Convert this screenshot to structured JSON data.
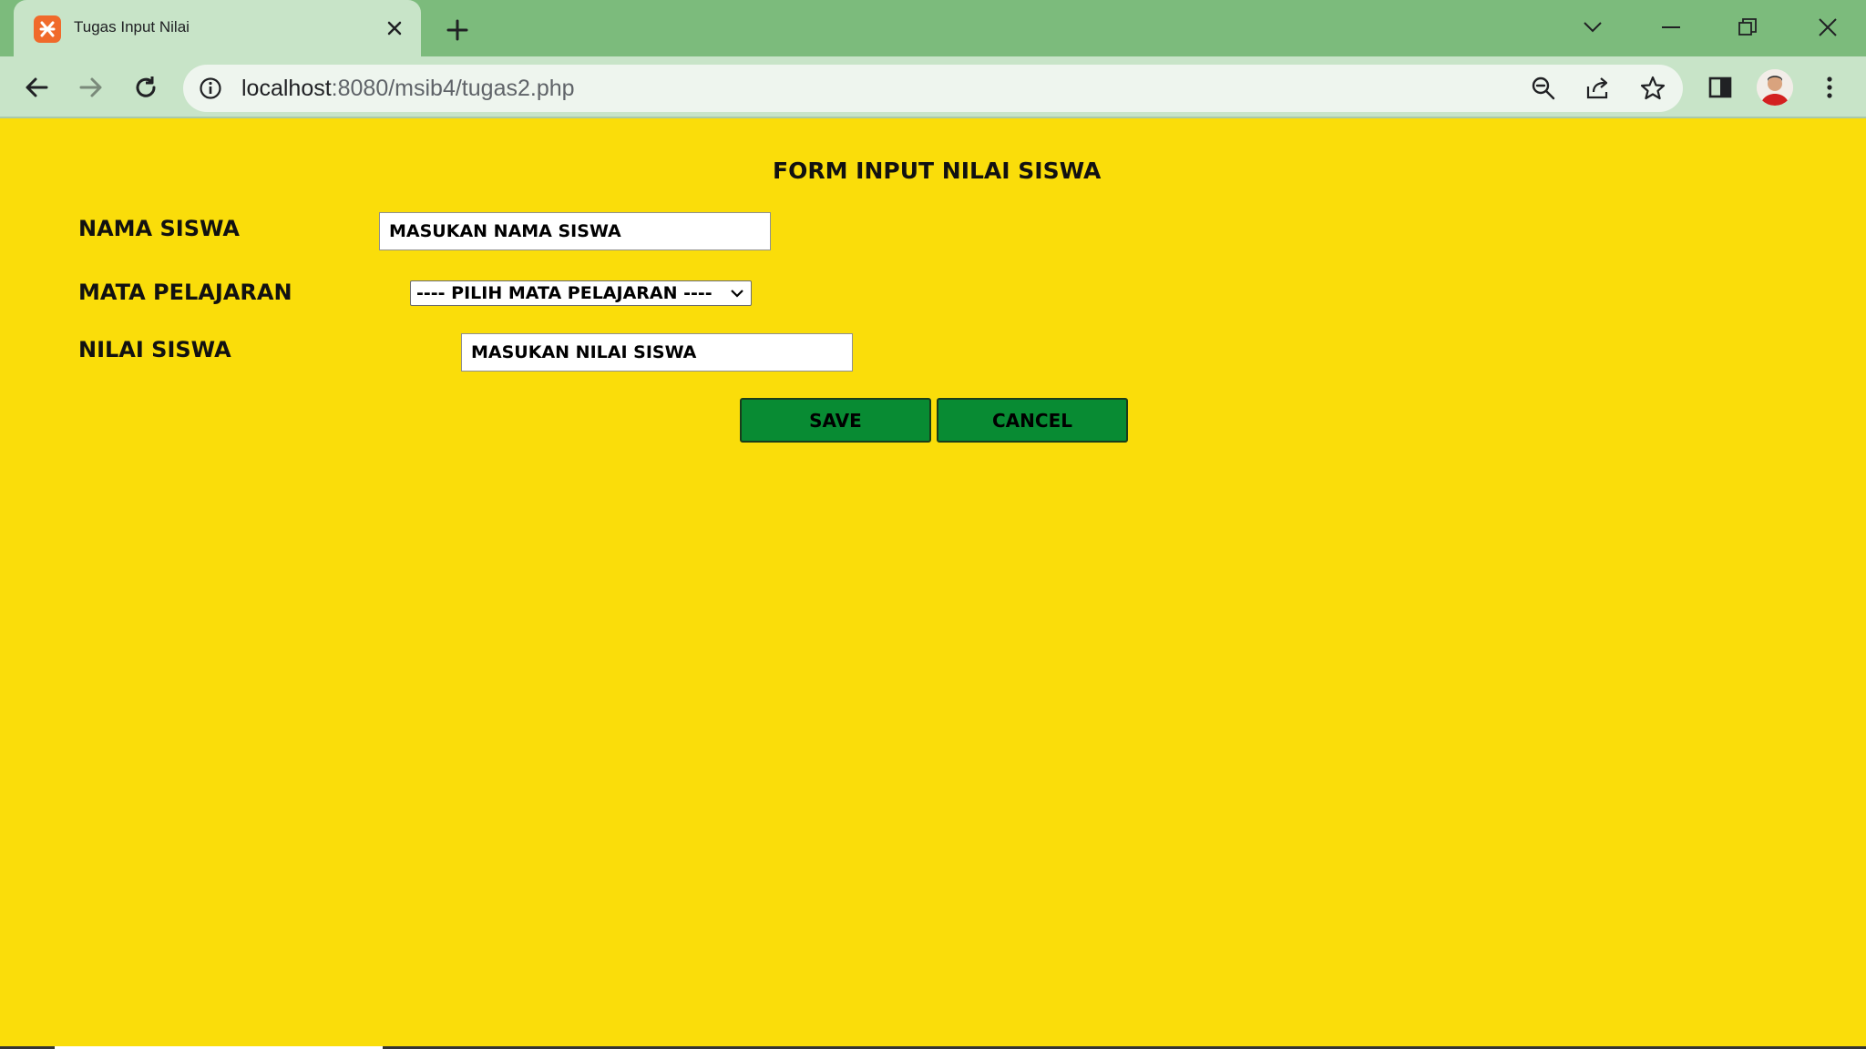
{
  "browser": {
    "tab_title": "Tugas Input Nilai",
    "url_host": "localhost",
    "url_rest": ":8080/msib4/tugas2.php"
  },
  "form": {
    "title": "FORM INPUT NILAI SISWA",
    "nama_label": "NAMA SISWA",
    "nama_placeholder": "MASUKAN NAMA SISWA",
    "mapel_label": "MATA PELAJARAN",
    "mapel_selected": "---- PILIH MATA PELAJARAN ----",
    "nilai_label": "NILAI SISWA",
    "nilai_placeholder": "MASUKAN NILAI SISWA",
    "save_label": "SAVE",
    "cancel_label": "CANCEL"
  },
  "colors": {
    "page_background": "#fadd0a",
    "button_background": "#088b33",
    "tabbar": "#7cbb7c",
    "toolbar": "#c8e4c8"
  }
}
